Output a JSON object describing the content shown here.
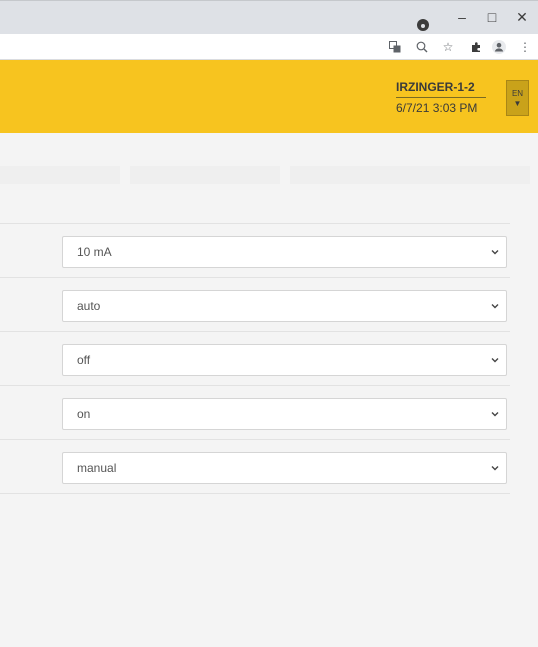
{
  "header": {
    "site_name": "IRZINGER-1-2",
    "datetime": "6/7/21 3:03 PM",
    "language": "EN"
  },
  "form": {
    "fields": [
      {
        "value": "10 mA"
      },
      {
        "value": "auto"
      },
      {
        "value": "off"
      },
      {
        "value": "on"
      },
      {
        "value": "manual"
      }
    ]
  },
  "browser": {
    "icons": [
      "translate-icon",
      "zoom-icon",
      "star-icon",
      "extensions-icon",
      "profile-icon",
      "menu-icon"
    ],
    "window_controls": [
      "minimize-icon",
      "maximize-icon",
      "close-icon"
    ]
  },
  "colors": {
    "header_bg": "#f7c41f",
    "lang_button_bg": "#c9a21a",
    "page_bg": "#f4f4f4"
  }
}
